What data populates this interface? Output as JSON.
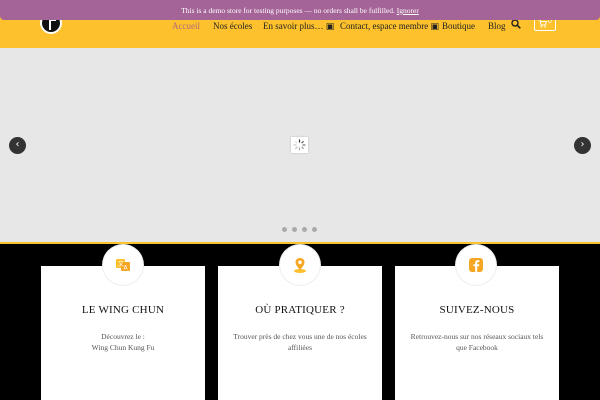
{
  "notice": {
    "text": "This is a demo store for testing purposes — no orders shall be fulfilled.",
    "dismiss_label": "Ignorer"
  },
  "nav": {
    "items": [
      {
        "label": "Accueil",
        "active": true
      },
      {
        "label": "Nos écoles",
        "active": false
      },
      {
        "label": "En savoir plus… ▣",
        "active": false
      },
      {
        "label": "Contact, espace membre ▣",
        "active": false
      },
      {
        "label": "Boutique",
        "active": false
      },
      {
        "label": "Blog",
        "active": false
      }
    ],
    "cart_count": "0"
  },
  "slider": {
    "prev_label": "‹",
    "next_label": "›",
    "slide_count": 4
  },
  "cards": [
    {
      "icon": "language-icon",
      "title": "LE WING CHUN",
      "text_line1": "Découvrez le :",
      "text_line2": "Wing Chun Kung Fu"
    },
    {
      "icon": "location-pin-icon",
      "title": "OÙ PRATIQUER ?",
      "text_line1": "Trouver près de chez vous une de nos écoles affiliées",
      "text_line2": ""
    },
    {
      "icon": "facebook-icon",
      "title": "SUIVEZ-NOUS",
      "text_line1": "Retrouvez-nous sur nos réseaux sociaux tels que Facebook",
      "text_line2": ""
    }
  ],
  "colors": {
    "brand_yellow": "#fdc12d",
    "notice_purple": "#a46497",
    "active_nav": "#b06a7e"
  }
}
